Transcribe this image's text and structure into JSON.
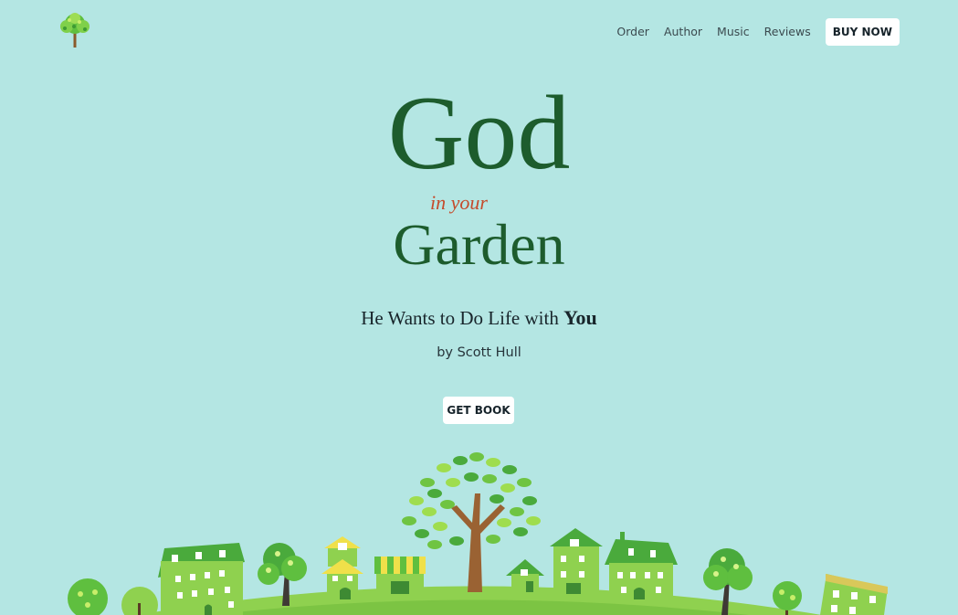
{
  "nav": {
    "items": [
      {
        "label": "Order"
      },
      {
        "label": "Author"
      },
      {
        "label": "Music"
      },
      {
        "label": "Reviews"
      }
    ],
    "buy_label": "BUY NOW"
  },
  "hero": {
    "title_main": "God",
    "title_connector": "in your",
    "title_second": "Garden",
    "subtitle_prefix": "He Wants to Do Life with ",
    "subtitle_emphasis": "You",
    "author": "by Scott Hull",
    "cta_label": "GET BOOK"
  },
  "colors": {
    "background": "#b4e6e3",
    "title_green": "#1d5c2d",
    "accent_red": "#c54b2b",
    "button_bg": "#ffffff",
    "grass": "#8fd14f"
  },
  "icons": {
    "logo": "tree-logo-icon"
  }
}
